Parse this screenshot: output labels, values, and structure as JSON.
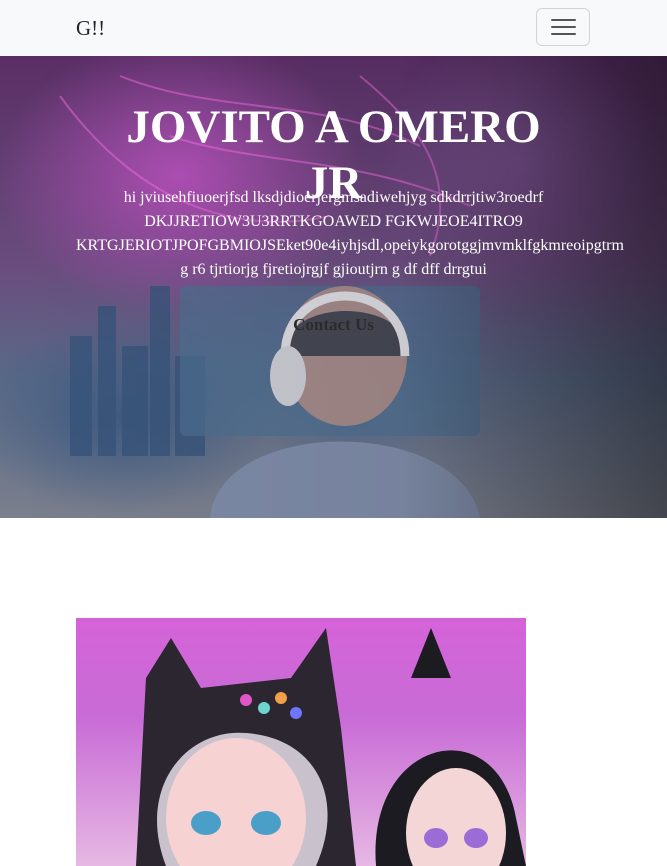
{
  "navbar": {
    "brand": "G!!",
    "toggler_icon": "hamburger-menu-icon"
  },
  "hero": {
    "title_line1": "JOVITO A OMERO",
    "title_line2": "JR",
    "text_lines": [
      "hi jviusehfiuoerjfsd lksdjdioerjergmsadiwehjyg sdkdrrjtiw3roedrf",
      "DKJJRETIOW3U3RRTKGOAWED FGKWJEOE4ITRO9",
      "KRTGJERIOTJPOFGBMIOJSEket90e4iyhjsdl,opeiykgorotggjmvmklfgkmreoipgtrm",
      "g r6 tjrtiorjg fjretiojrgjf gjioutjrn g df dff drrgtui"
    ],
    "contact_label": "Contact Us"
  },
  "colors": {
    "navbar_bg": "#f8f9fa",
    "hero_text": "#ffffff",
    "contact_text": "#2b2b2b"
  }
}
